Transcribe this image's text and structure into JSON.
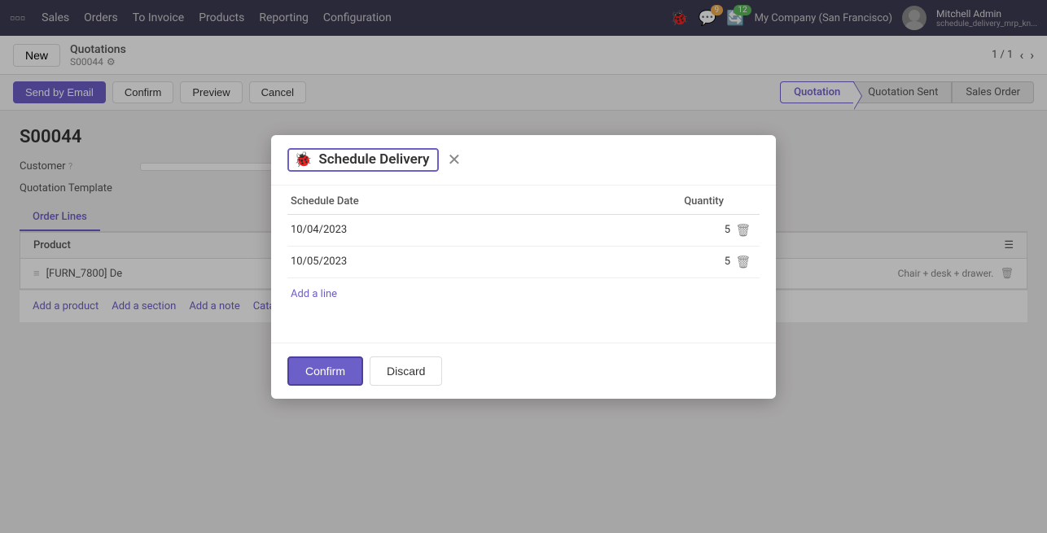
{
  "app": {
    "name": "Sales"
  },
  "topnav": {
    "nav_items": [
      "Sales",
      "Orders",
      "To Invoice",
      "Products",
      "Reporting",
      "Configuration"
    ],
    "notifications_count": "9",
    "updates_count": "12",
    "company": "My Company (San Francisco)",
    "user_name": "Mitchell Admin",
    "user_script": "schedule_delivery_mrp_kn..."
  },
  "subnav": {
    "new_label": "New",
    "breadcrumb_title": "Quotations",
    "breadcrumb_sub": "S00044",
    "pagination": "1 / 1"
  },
  "actionbar": {
    "send_by_email_label": "Send by Email",
    "confirm_label": "Confirm",
    "preview_label": "Preview",
    "cancel_label": "Cancel",
    "status_pills": [
      "Quotation",
      "Quotation Sent",
      "Sales Order"
    ]
  },
  "record": {
    "id": "S00044",
    "customer_label": "Customer",
    "quotation_template_label": "Quotation Template"
  },
  "tabs": [
    "Order Lines"
  ],
  "table": {
    "product_col": "Product",
    "rows": [
      {
        "code": "[FURN_7800] De",
        "desc": "Chair + desk + drawer."
      }
    ]
  },
  "bottom_actions": [
    "Add a product",
    "Add a section",
    "Add a note",
    "Catalog"
  ],
  "modal": {
    "title": "Schedule Delivery",
    "icon": "🐞",
    "close_title": "Close",
    "schedule_date_col": "Schedule Date",
    "quantity_col": "Quantity",
    "rows": [
      {
        "date": "10/04/2023",
        "qty": "5"
      },
      {
        "date": "10/05/2023",
        "qty": "5"
      }
    ],
    "add_line_label": "Add a line",
    "confirm_label": "Confirm",
    "discard_label": "Discard"
  }
}
